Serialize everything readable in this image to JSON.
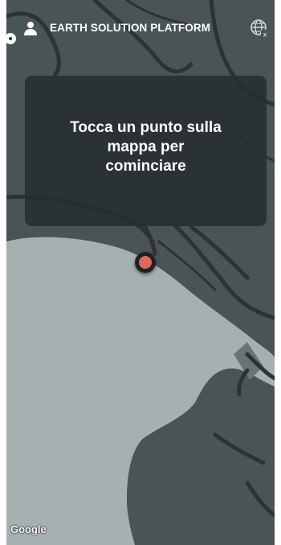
{
  "header": {
    "title": "EARTH SOLUTION PLATFORM",
    "user_icon": "user-icon",
    "language_icon": "globe-translate-icon"
  },
  "overlay": {
    "message": "Tocca un punto sulla mappa per cominciare"
  },
  "map": {
    "attribution": "Google",
    "land_color": "#4a5356",
    "water_color": "#a7b0b1",
    "road_color": "#2b3336",
    "marker_color": "#e0665e"
  }
}
